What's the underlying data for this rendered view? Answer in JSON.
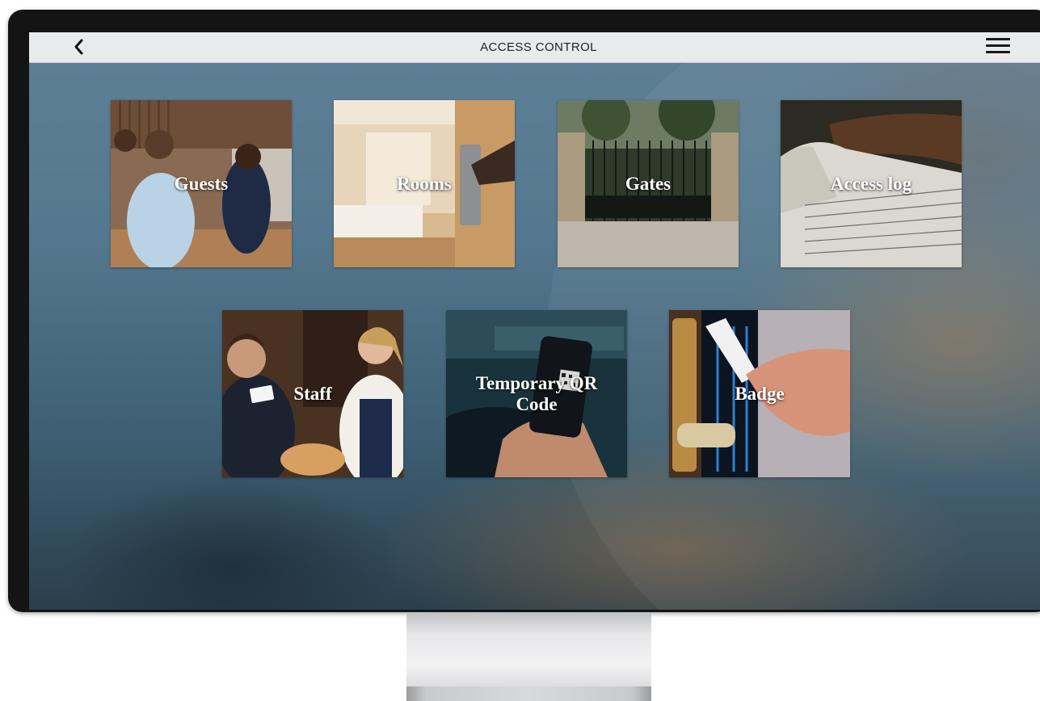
{
  "app": {
    "title": "ACCESS CONTROL"
  },
  "toolbar": {
    "back_icon": "chevron-left-icon",
    "menu_icon": "hamburger-menu-icon"
  },
  "tiles": [
    {
      "label": "Guests",
      "image": "reception-handshake-photo"
    },
    {
      "label": "Rooms",
      "image": "hotel-room-door-photo"
    },
    {
      "label": "Gates",
      "image": "iron-gate-photo"
    },
    {
      "label": "Access log",
      "image": "logbook-photo"
    },
    {
      "label": "Staff",
      "image": "staff-keycard-photo"
    },
    {
      "label": "Temporary QR Code",
      "image": "phone-qr-photo"
    },
    {
      "label": "Badge",
      "image": "badge-door-lock-photo"
    }
  ],
  "colors": {
    "topbar": "#e9eaeb",
    "tile_text": "#ffffff",
    "monitor_bezel": "#141414"
  }
}
